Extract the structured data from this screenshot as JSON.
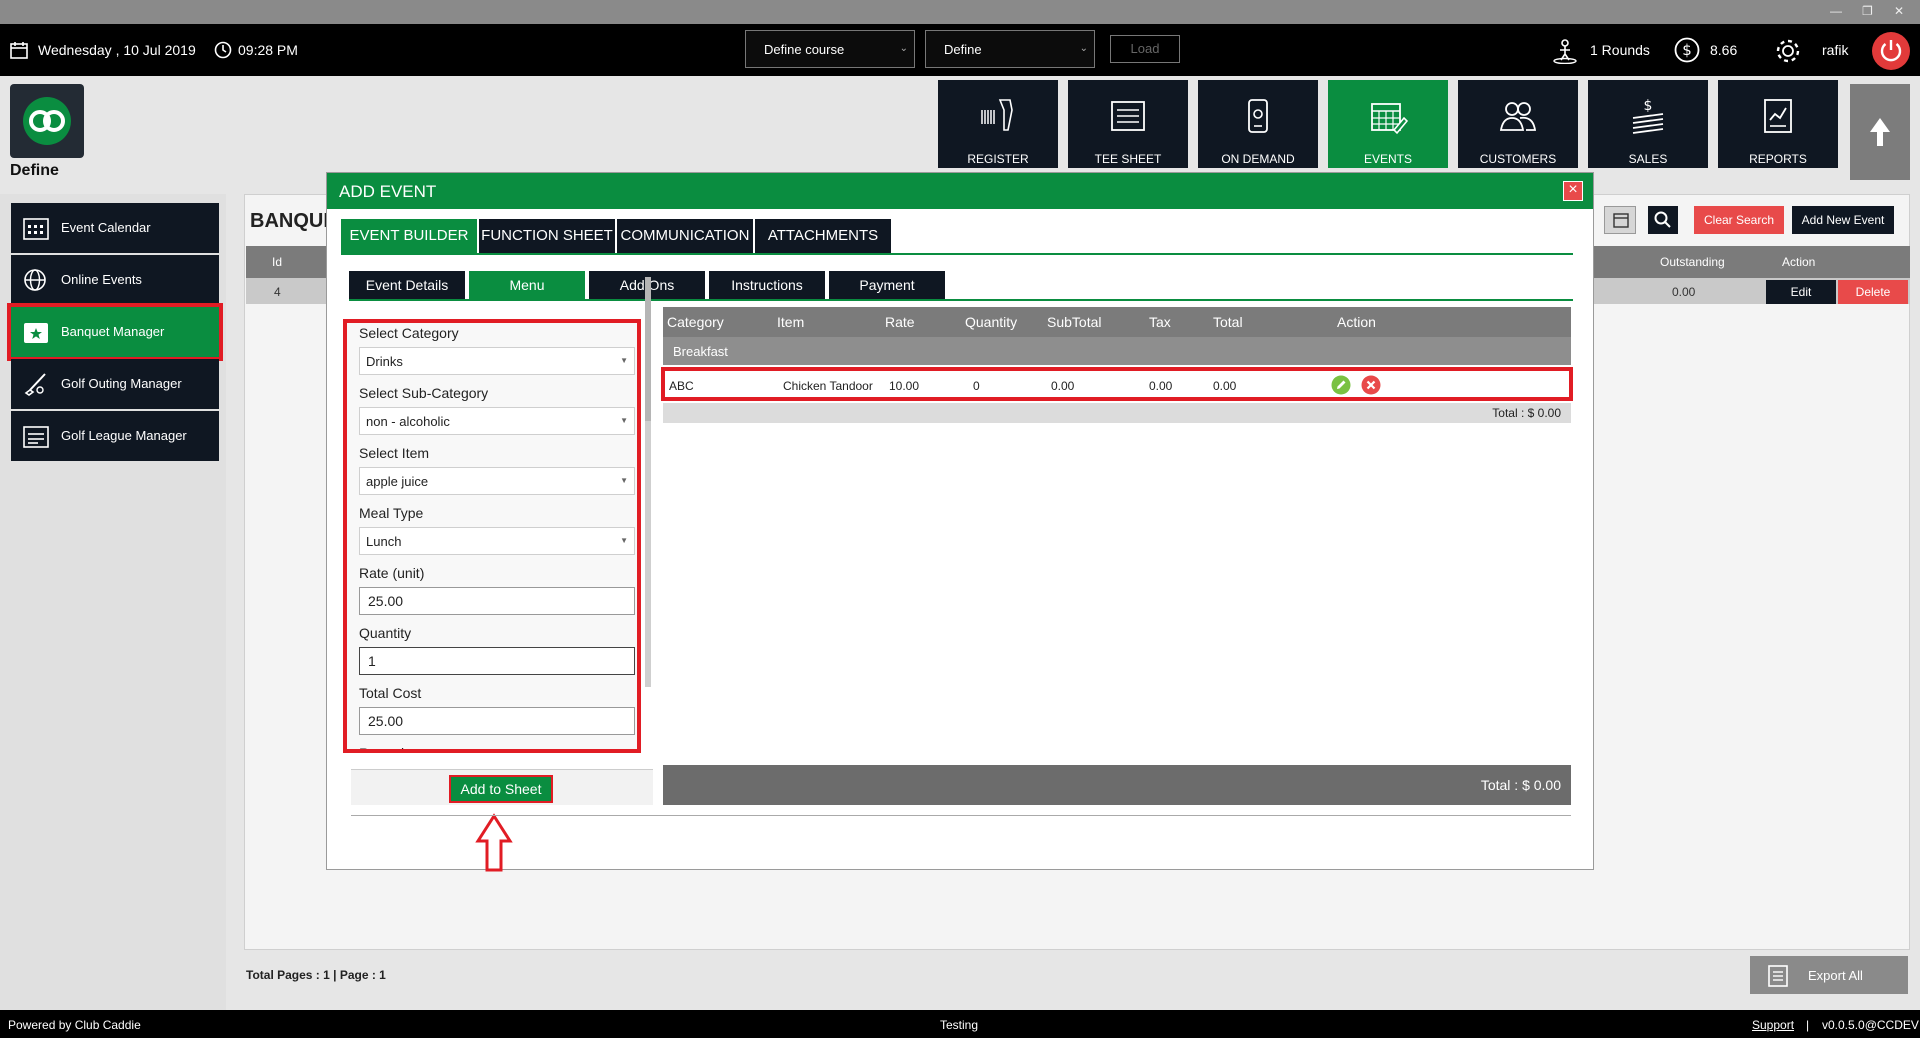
{
  "topbar": {
    "date": "Wednesday ,  10 Jul 2019",
    "time": "09:28 PM",
    "course_select": "Define course",
    "define_select": "Define",
    "load": "Load",
    "rounds": "1 Rounds",
    "balance": "8.66",
    "user": "rafik"
  },
  "brand": {
    "label": "Define"
  },
  "modules": [
    {
      "label": "REGISTER",
      "icon": "barcode-scanner-icon"
    },
    {
      "label": "TEE SHEET",
      "icon": "list-sheet-icon"
    },
    {
      "label": "ON DEMAND",
      "icon": "mobile-phone-icon"
    },
    {
      "label": "EVENTS",
      "icon": "calendar-edit-icon"
    },
    {
      "label": "CUSTOMERS",
      "icon": "people-icon"
    },
    {
      "label": "SALES",
      "icon": "dollar-stack-icon"
    },
    {
      "label": "REPORTS",
      "icon": "report-chart-icon"
    }
  ],
  "sidebar": {
    "items": [
      {
        "label": "Event Calendar"
      },
      {
        "label": "Online Events"
      },
      {
        "label": "Banquet Manager"
      },
      {
        "label": "Golf Outing Manager"
      },
      {
        "label": "Golf League Manager"
      }
    ]
  },
  "main": {
    "title": "BANQUE",
    "clear_search": "Clear Search",
    "add_new_event": "Add New Event",
    "columns": {
      "id": "Id",
      "outstanding": "Outstanding",
      "action": "Action"
    },
    "row": {
      "id": "4",
      "outstanding": "0.00",
      "edit": "Edit",
      "delete": "Delete"
    },
    "total_pages": "Total Pages : 1 | Page : 1",
    "export_all": "Export All"
  },
  "modal": {
    "title": "ADD EVENT",
    "close": "×",
    "tabs": [
      "EVENT BUILDER",
      "FUNCTION SHEET",
      "COMMUNICATION",
      "ATTACHMENTS"
    ],
    "subtabs": [
      "Event Details",
      "Menu",
      "Add Ons",
      "Instructions",
      "Payment"
    ],
    "form": {
      "category_label": "Select Category",
      "category_value": "Drinks",
      "subcategory_label": "Select Sub-Category",
      "subcategory_value": "non - alcoholic",
      "item_label": "Select Item",
      "item_value": "apple juice",
      "meal_label": "Meal Type",
      "meal_value": "Lunch",
      "rate_label": "Rate (unit)",
      "rate_value": "25.00",
      "qty_label": "Quantity",
      "qty_value": "1",
      "total_label": "Total Cost",
      "total_value": "25.00",
      "remarks_label": "Remarks"
    },
    "add_to_sheet": "Add to Sheet",
    "table": {
      "headers": [
        "Category",
        "Item",
        "Rate",
        "Quantity",
        "SubTotal",
        "Tax",
        "Total",
        "Action"
      ],
      "group": "Breakfast",
      "row": {
        "category": "ABC",
        "item": "Chicken Tandoor",
        "rate": "10.00",
        "quantity": "0",
        "subtotal": "0.00",
        "tax": "0.00",
        "total": "0.00"
      },
      "subtotal": "Total :   $ 0.00",
      "grand_total": "Total :  $ 0.00"
    }
  },
  "footer": {
    "powered": "Powered by Club Caddie",
    "env": "Testing",
    "support": "Support",
    "sep": "|",
    "version": "v0.0.5.0@CCDEV"
  },
  "colors": {
    "green": "#0a8d40",
    "dark": "#0f1722",
    "red": "#e11c24",
    "danger": "#e84a4a"
  }
}
